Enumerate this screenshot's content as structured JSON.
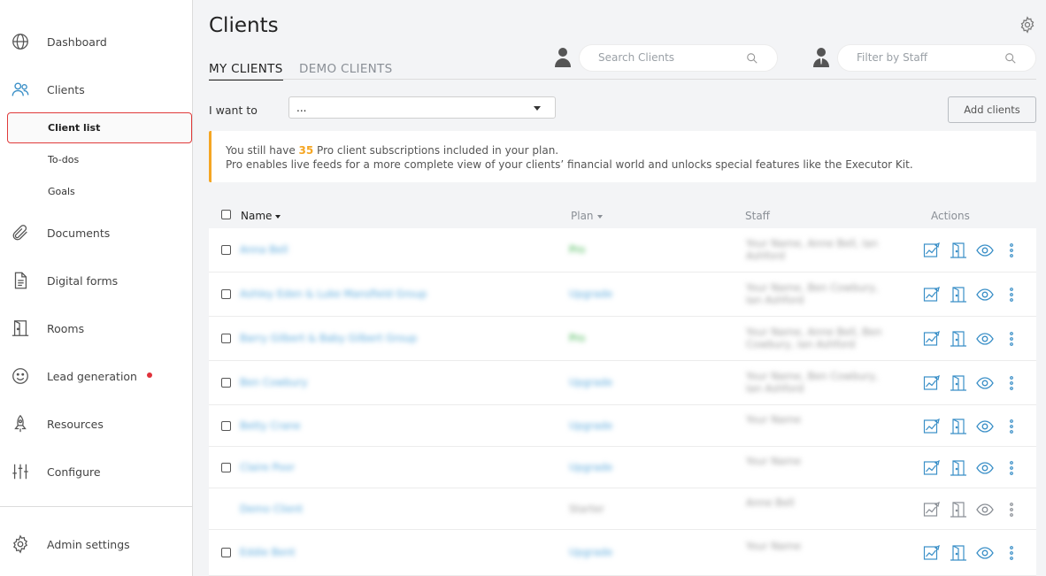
{
  "sidebar": {
    "items": [
      {
        "label": "Dashboard",
        "icon": "globe-icon"
      },
      {
        "label": "Clients",
        "icon": "people-icon"
      },
      {
        "label": "Documents",
        "icon": "paperclip-icon"
      },
      {
        "label": "Digital forms",
        "icon": "document-icon"
      },
      {
        "label": "Rooms",
        "icon": "door-icon"
      },
      {
        "label": "Lead generation",
        "icon": "smiley-icon"
      },
      {
        "label": "Resources",
        "icon": "rocket-icon"
      },
      {
        "label": "Configure",
        "icon": "sliders-icon"
      }
    ],
    "sub_items": [
      {
        "label": "Client list"
      },
      {
        "label": "To-dos"
      },
      {
        "label": "Goals"
      }
    ],
    "admin_label": "Admin settings",
    "accent_color": "#3a8fc7",
    "highlight_color": "#e03a3a",
    "notification_color": "#e0323b"
  },
  "header": {
    "title": "Clients",
    "tabs": [
      {
        "label": "MY CLIENTS"
      },
      {
        "label": "DEMO CLIENTS"
      }
    ],
    "search_placeholder": "Search Clients",
    "staff_filter_placeholder": "Filter by Staff"
  },
  "toolbar": {
    "iwant_label": "I want to",
    "iwant_value": "...",
    "add_clients_label": "Add clients"
  },
  "banner": {
    "prefix": "You still have ",
    "count": "35",
    "suffix": " Pro client subscriptions included in your plan.",
    "line2": "Pro enables live feeds for a more complete view of your clients’ financial world and unlocks special features like the Executor Kit.",
    "accent_color": "#f5a623"
  },
  "table": {
    "headers": {
      "name": "Name",
      "plan": "Plan",
      "staff": "Staff",
      "actions": "Actions"
    },
    "rows": [
      {
        "name": "Anna Bell",
        "plan": "Pro",
        "plan_color": "green",
        "staff": "Your Name, Anne Bell, Ian Ashford"
      },
      {
        "name": "Ashley Eden & Luke Mansfield Group",
        "plan": "Upgrade",
        "plan_color": "blue",
        "staff": "Your Name, Ben Cowbury, Ian Ashford"
      },
      {
        "name": "Barry Gilbert & Baby Gilbert Group",
        "plan": "Pro",
        "plan_color": "green",
        "staff": "Your Name, Anne Bell, Ben Cowbury, Ian Ashford"
      },
      {
        "name": "Ben Cowbury",
        "plan": "Upgrade",
        "plan_color": "blue",
        "staff": "Your Name, Ben Cowbury, Ian Ashford"
      },
      {
        "name": "Betty Crane",
        "plan": "Upgrade",
        "plan_color": "blue",
        "staff": "Your Name"
      },
      {
        "name": "Claire Poor",
        "plan": "Upgrade",
        "plan_color": "blue",
        "staff": "Your Name"
      },
      {
        "name": "Demo Client",
        "plan": "Starter",
        "plan_color": "grey",
        "staff": "Anne Bell"
      },
      {
        "name": "Eddie Bent",
        "plan": "Upgrade",
        "plan_color": "blue",
        "staff": "Your Name"
      }
    ]
  }
}
